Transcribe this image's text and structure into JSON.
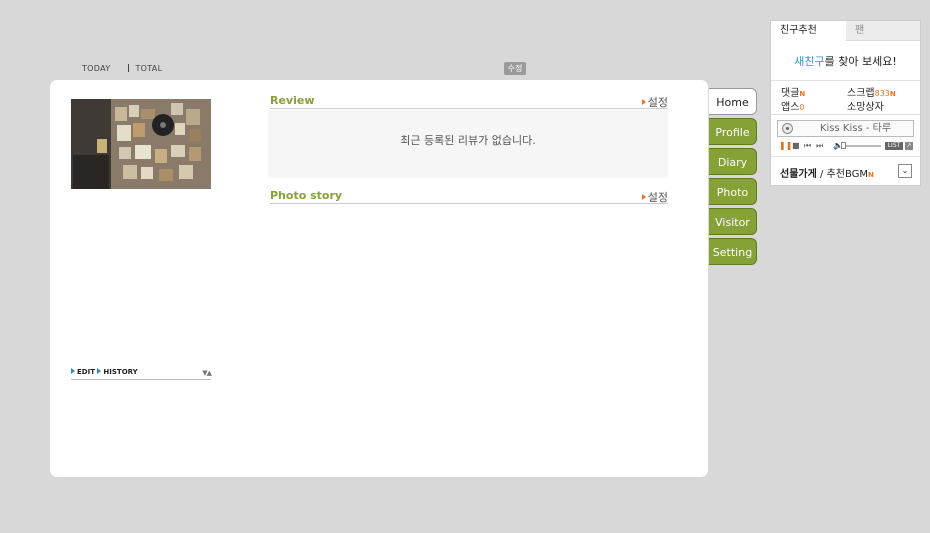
{
  "counter": {
    "today_label": "TODAY",
    "total_label": "TOTAL"
  },
  "edit_badge": "수정",
  "profile": {
    "image_alt": "profile photo collage"
  },
  "edit_history": {
    "edit_label": "EDIT",
    "history_label": "HISTORY",
    "arrows": "▼▲"
  },
  "review": {
    "title": "Review",
    "setting": "설정",
    "empty_message": "최근 등록된 리뷰가 없습니다."
  },
  "photo_story": {
    "title": "Photo story",
    "setting": "설정"
  },
  "nav": [
    {
      "label": "Home",
      "active": true
    },
    {
      "label": "Profile",
      "active": false
    },
    {
      "label": "Diary",
      "active": false
    },
    {
      "label": "Photo",
      "active": false
    },
    {
      "label": "Visitor",
      "active": false
    },
    {
      "label": "Setting",
      "active": false
    }
  ],
  "side": {
    "tab_recommend": "친구추천",
    "tab_fan": "팬",
    "find_link": "새친구",
    "find_rest": "를 찾아 보세요!",
    "comments_label": "댓글",
    "comments_new": "N",
    "scrap_label": "스크랩",
    "scrap_count": "833",
    "scrap_new": "N",
    "apps_label": "앱스",
    "apps_count": "0",
    "wishlist_label": "소망상자",
    "bgm_song": "Kiss Kiss - 타루",
    "list_label": "LIST",
    "popup_label": "↗",
    "gift_label": "선물가게",
    "gift_sep": " / ",
    "bgm_recommend": "추천BGM",
    "bgm_new": "N",
    "dropdown_icon": "⌄"
  },
  "colors": {
    "accent_green": "#86a236",
    "accent_orange": "#e8731c",
    "link_blue": "#2a9ad0"
  }
}
